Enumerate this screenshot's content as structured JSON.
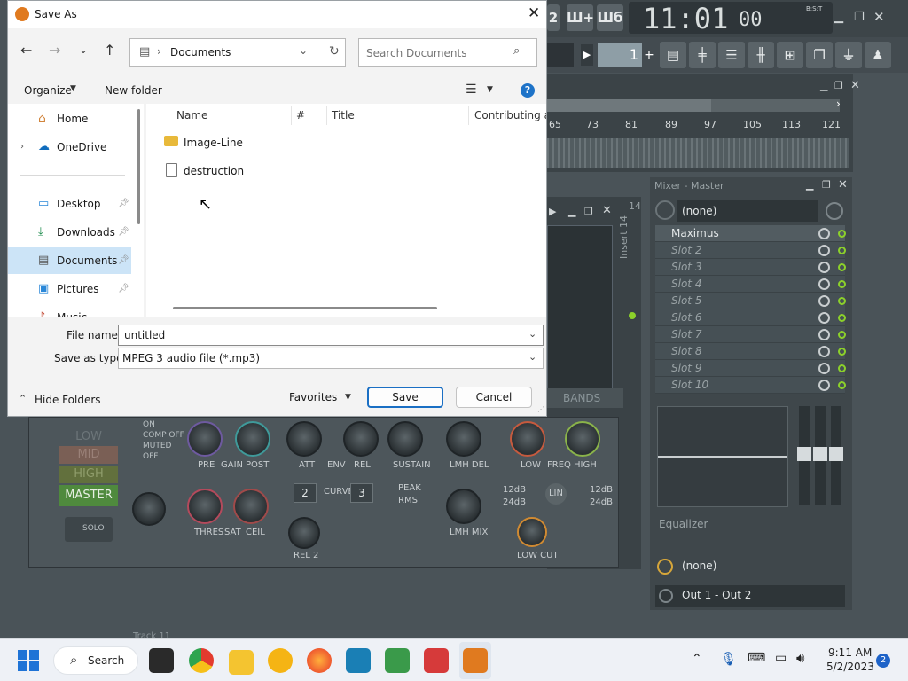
{
  "dialog": {
    "title": "Save As",
    "address": {
      "location": "Documents"
    },
    "search_placeholder": "Search Documents",
    "toolbar": {
      "organize_label": "Organize",
      "new_folder_label": "New folder"
    },
    "nav": [
      {
        "label": "Home",
        "icon": "home-icon"
      },
      {
        "label": "OneDrive",
        "icon": "cloud-icon"
      },
      {
        "label": "Desktop",
        "icon": "desktop-icon"
      },
      {
        "label": "Downloads",
        "icon": "download-icon"
      },
      {
        "label": "Documents",
        "icon": "documents-icon",
        "selected": true
      },
      {
        "label": "Pictures",
        "icon": "pictures-icon"
      },
      {
        "label": "Music",
        "icon": "music-icon"
      }
    ],
    "columns": [
      "Name",
      "#",
      "Title",
      "Contributing ar"
    ],
    "files": [
      {
        "name": "Image-Line",
        "type": "folder"
      },
      {
        "name": "destruction",
        "type": "file"
      }
    ],
    "file_name_label": "File name:",
    "file_name_value": "untitled",
    "save_type_label": "Save as type:",
    "save_type_value": "MPEG 3 audio file (*.mp3)",
    "hide_folders_label": "Hide Folders",
    "favorites_label": "Favorites",
    "save_label": "Save",
    "cancel_label": "Cancel"
  },
  "fl": {
    "clock": "11:01",
    "clock_small": "00",
    "bst": "B:S:T",
    "pattern_num": "1",
    "ruler": [
      "65",
      "73",
      "81",
      "89",
      "97",
      "105",
      "113",
      "121"
    ],
    "mixer_title": "Mixer - Master",
    "insert_label": "Insert 14",
    "insert_number": "14",
    "preset_none": "(none)",
    "slots": [
      "Maximus",
      "Slot 2",
      "Slot 3",
      "Slot 4",
      "Slot 5",
      "Slot 6",
      "Slot 7",
      "Slot 8",
      "Slot 9",
      "Slot 10"
    ],
    "equalizer_label": "Equalizer",
    "eq_preset": "(none)",
    "output": "Out 1 - Out 2",
    "maximus": {
      "bands": [
        "LOW",
        "MID",
        "HIGH",
        "MASTER"
      ],
      "mode_labels": [
        "ON",
        "COMP OFF",
        "MUTED",
        "OFF"
      ],
      "knobs_top": [
        "PRE",
        "GAIN",
        "POST",
        "ATT",
        "ENV",
        "REL",
        "SUSTAIN",
        "LMH DEL",
        "LOW",
        "FREQ",
        "HIGH"
      ],
      "knobs_bottom": [
        "THRES",
        "SAT",
        "CEIL",
        "REL 2",
        "LMH MIX",
        "LOW CUT"
      ],
      "solo_label": "SOLO",
      "curve_label": "CURVE",
      "curve_value": "3",
      "att_value": "2",
      "peak_label": "PEAK",
      "rms_label": "RMS",
      "lin_label": "LIN",
      "db12": "12dB",
      "db24": "24dB",
      "bands_tab": "BANDS",
      "track_label": "Track 11"
    }
  },
  "taskbar": {
    "search_label": "Search",
    "time": "9:11 AM",
    "date": "5/2/2023",
    "notifications": "2",
    "apps": [
      "windows-icon",
      "task-view-icon",
      "chrome-icon",
      "file-explorer-icon",
      "norton-icon",
      "firefox-icon",
      "keyboard-app-icon",
      "notepad-icon",
      "media-app-icon",
      "fl-studio-icon"
    ]
  }
}
